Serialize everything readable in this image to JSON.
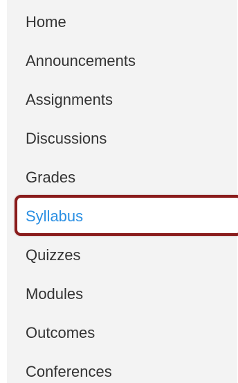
{
  "course_nav": {
    "items": [
      {
        "label": "Home",
        "active": false
      },
      {
        "label": "Announcements",
        "active": false
      },
      {
        "label": "Assignments",
        "active": false
      },
      {
        "label": "Discussions",
        "active": false
      },
      {
        "label": "Grades",
        "active": false
      },
      {
        "label": "Syllabus",
        "active": true
      },
      {
        "label": "Quizzes",
        "active": false
      },
      {
        "label": "Modules",
        "active": false
      },
      {
        "label": "Outcomes",
        "active": false
      },
      {
        "label": "Conferences",
        "active": false
      }
    ],
    "colors": {
      "panel_background": "#f3f3f3",
      "text": "#333333",
      "active_text": "#2a8fe3",
      "active_highlight_border": "#8a1c1c"
    }
  }
}
